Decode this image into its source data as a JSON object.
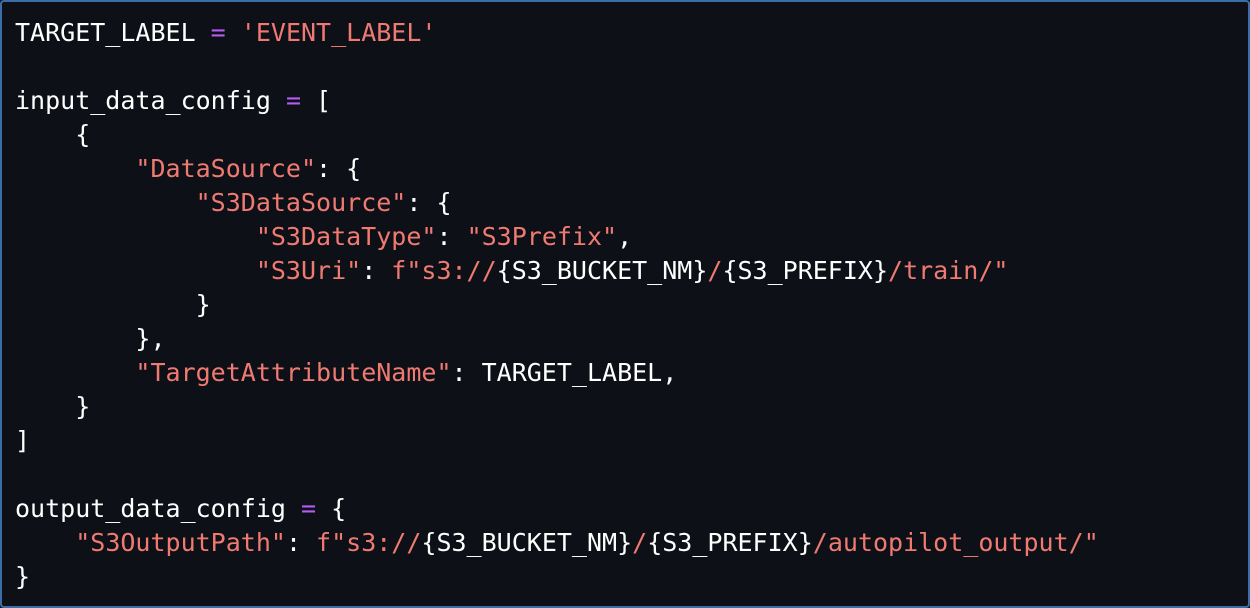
{
  "colors": {
    "background": "#0d1117",
    "border": "#3b6ea8",
    "plain_text": "#ffffff",
    "operator": "#b45cf0",
    "string": "#f07a72"
  },
  "code_lines": [
    [
      {
        "t": "plain",
        "v": "TARGET_LABEL "
      },
      {
        "t": "op",
        "v": "="
      },
      {
        "t": "plain",
        "v": " "
      },
      {
        "t": "string",
        "v": "'EVENT_LABEL'"
      }
    ],
    [],
    [
      {
        "t": "plain",
        "v": "input_data_config "
      },
      {
        "t": "op",
        "v": "="
      },
      {
        "t": "plain",
        "v": " ["
      }
    ],
    [
      {
        "t": "plain",
        "v": "    {"
      }
    ],
    [
      {
        "t": "plain",
        "v": "        "
      },
      {
        "t": "string",
        "v": "\"DataSource\""
      },
      {
        "t": "plain",
        "v": ": {"
      }
    ],
    [
      {
        "t": "plain",
        "v": "            "
      },
      {
        "t": "string",
        "v": "\"S3DataSource\""
      },
      {
        "t": "plain",
        "v": ": {"
      }
    ],
    [
      {
        "t": "plain",
        "v": "                "
      },
      {
        "t": "string",
        "v": "\"S3DataType\""
      },
      {
        "t": "plain",
        "v": ": "
      },
      {
        "t": "string",
        "v": "\"S3Prefix\""
      },
      {
        "t": "plain",
        "v": ","
      }
    ],
    [
      {
        "t": "plain",
        "v": "                "
      },
      {
        "t": "string",
        "v": "\"S3Uri\""
      },
      {
        "t": "plain",
        "v": ": "
      },
      {
        "t": "string",
        "v": "f\"s3://"
      },
      {
        "t": "interp",
        "v": "{S3_BUCKET_NM}"
      },
      {
        "t": "string",
        "v": "/"
      },
      {
        "t": "interp",
        "v": "{S3_PREFIX}"
      },
      {
        "t": "string",
        "v": "/train/\""
      }
    ],
    [
      {
        "t": "plain",
        "v": "            }"
      }
    ],
    [
      {
        "t": "plain",
        "v": "        },"
      }
    ],
    [
      {
        "t": "plain",
        "v": "        "
      },
      {
        "t": "string",
        "v": "\"TargetAttributeName\""
      },
      {
        "t": "plain",
        "v": ": TARGET_LABEL,"
      }
    ],
    [
      {
        "t": "plain",
        "v": "    }"
      }
    ],
    [
      {
        "t": "plain",
        "v": "]"
      }
    ],
    [],
    [
      {
        "t": "plain",
        "v": "output_data_config "
      },
      {
        "t": "op",
        "v": "="
      },
      {
        "t": "plain",
        "v": " {"
      }
    ],
    [
      {
        "t": "plain",
        "v": "    "
      },
      {
        "t": "string",
        "v": "\"S3OutputPath\""
      },
      {
        "t": "plain",
        "v": ": "
      },
      {
        "t": "string",
        "v": "f\"s3://"
      },
      {
        "t": "interp",
        "v": "{S3_BUCKET_NM}"
      },
      {
        "t": "string",
        "v": "/"
      },
      {
        "t": "interp",
        "v": "{S3_PREFIX}"
      },
      {
        "t": "string",
        "v": "/autopilot_output/\""
      }
    ],
    [
      {
        "t": "plain",
        "v": "}"
      }
    ]
  ]
}
